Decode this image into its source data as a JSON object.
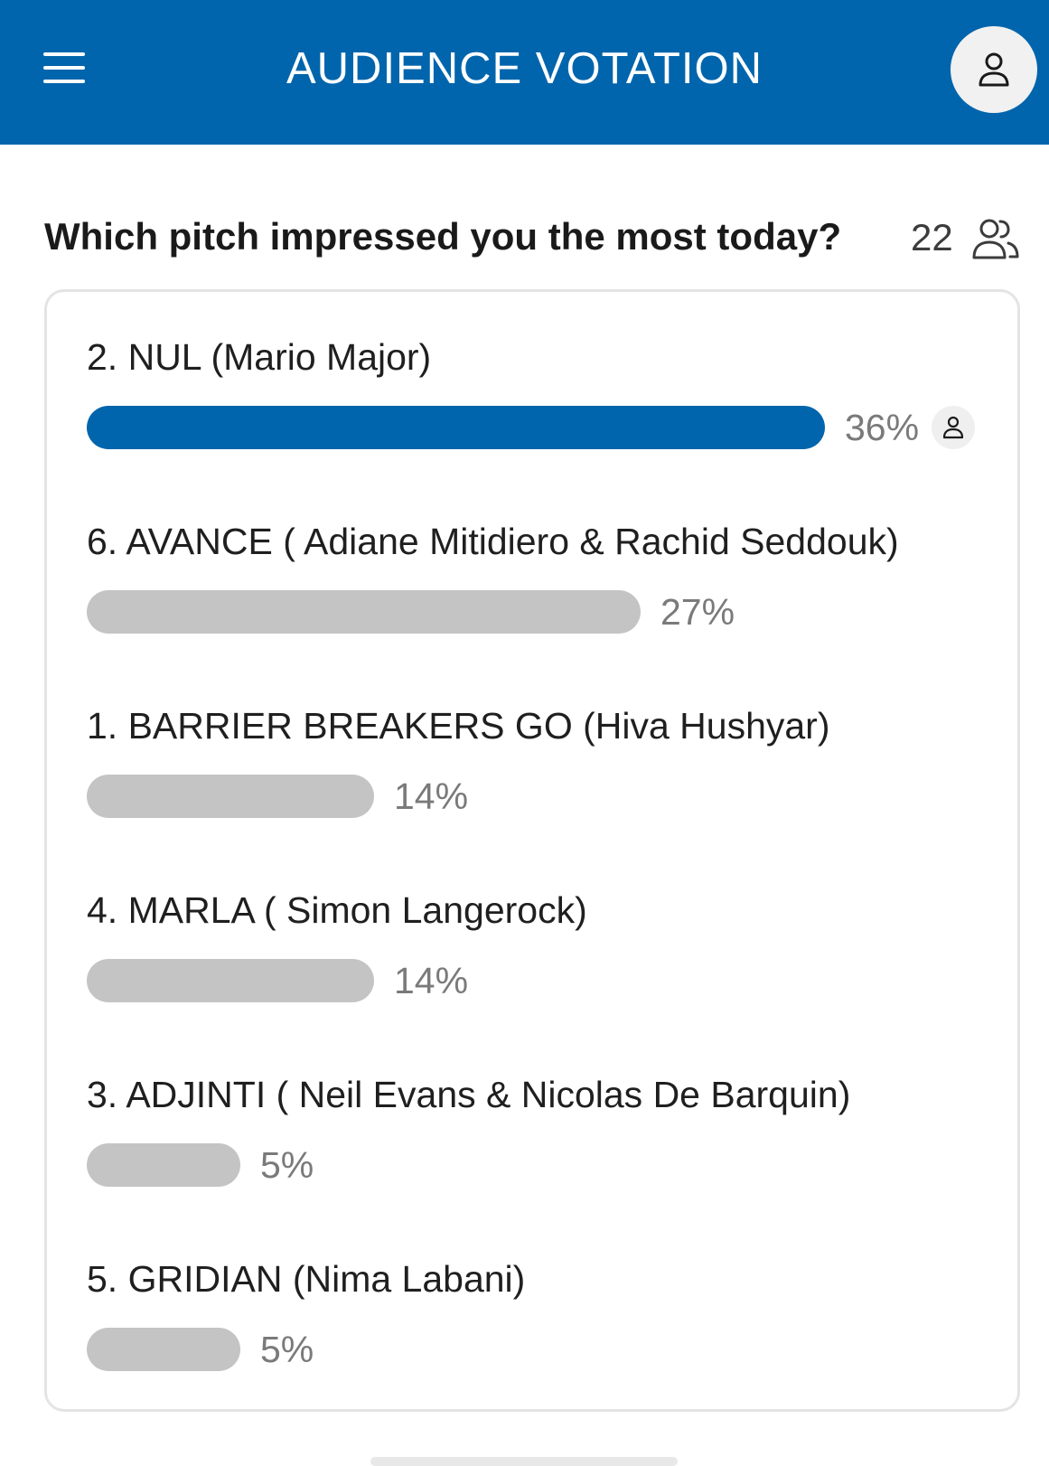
{
  "header": {
    "title": "AUDIENCE VOTATION",
    "menu_icon": "hamburger-icon",
    "profile_icon": "user-icon"
  },
  "poll": {
    "question": "Which pitch impressed you the most today?",
    "participants": "22",
    "participants_icon": "people-icon",
    "options": [
      {
        "label": "2. NUL (Mario Major)",
        "percent_text": "36%",
        "percent": 36,
        "my_vote": true
      },
      {
        "label": "6. AVANCE ( Adiane Mitidiero & Rachid Seddouk)",
        "percent_text": "27%",
        "percent": 27,
        "my_vote": false
      },
      {
        "label": "1. BARRIER BREAKERS GO (Hiva Hushyar)",
        "percent_text": "14%",
        "percent": 14,
        "my_vote": false
      },
      {
        "label": "4. MARLA ( Simon Langerock)",
        "percent_text": "14%",
        "percent": 14,
        "my_vote": false
      },
      {
        "label": "3. ADJINTI ( Neil Evans & Nicolas De Barquin)",
        "percent_text": "5%",
        "percent": 5,
        "my_vote": false
      },
      {
        "label": "5. GRIDIAN (Nima Labani)",
        "percent_text": "5%",
        "percent": 5,
        "my_vote": false
      }
    ]
  },
  "colors": {
    "brand": "#0065ac",
    "bar_inactive": "#c4c4c4"
  }
}
